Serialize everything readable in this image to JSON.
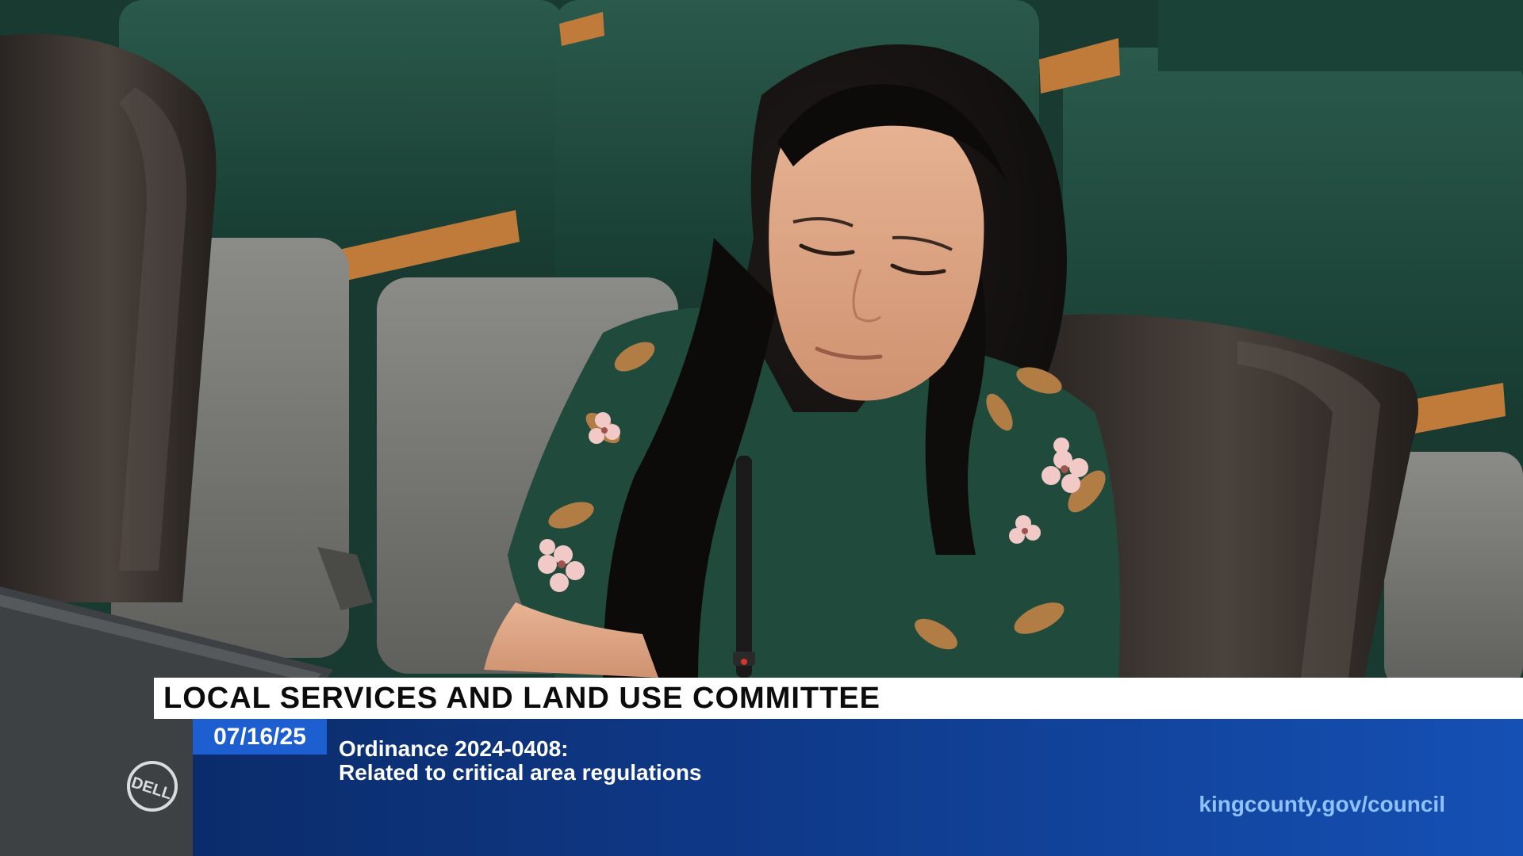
{
  "overlay": {
    "committee_title": "LOCAL SERVICES AND LAND USE COMMITTEE",
    "date": "07/16/25",
    "ordinance_line1": "Ordinance 2024-0408:",
    "ordinance_line2": "Related to critical area regulations",
    "website": "kingcounty.gov/council"
  },
  "laptop": {
    "logo_text": "DELL"
  },
  "colors": {
    "panel_blue": "#0f3a8a",
    "badge_blue": "#1d5fd0",
    "url_blue": "#8fc2ff",
    "seat_green": "#1f4d40",
    "armrest_orange": "#c07a3a"
  }
}
